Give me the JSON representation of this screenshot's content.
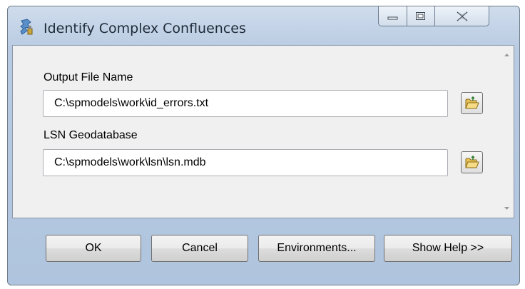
{
  "window": {
    "title": "Identify Complex Confluences",
    "icon": "tool-icon"
  },
  "caption_buttons": [
    "minimize-icon",
    "maximize-icon",
    "close-icon"
  ],
  "form": {
    "output_file": {
      "label": "Output File Name",
      "value": "C:\\spmodels\\work\\id_errors.txt",
      "browse_icon": "open-folder-icon"
    },
    "lsn_geodatabase": {
      "label": "LSN Geodatabase",
      "value": "C:\\spmodels\\work\\lsn\\lsn.mdb",
      "browse_icon": "open-folder-icon"
    }
  },
  "buttons": {
    "ok": "OK",
    "cancel": "Cancel",
    "environments": "Environments...",
    "show_help": "Show Help >>"
  },
  "colors": {
    "frame": "#b9cbe2",
    "panel": "#f0f0f0"
  }
}
